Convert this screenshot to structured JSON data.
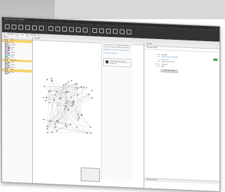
{
  "window": {
    "title": "Oxygen Forensic Detective",
    "controls": [
      "–",
      "□",
      "×"
    ]
  },
  "ribbon": {
    "buttons": [
      "",
      "",
      "",
      "",
      "",
      "",
      "",
      "",
      "",
      "",
      "",
      "",
      "",
      "",
      "",
      "",
      "",
      ""
    ]
  },
  "tabs": [
    "Start page",
    "Data",
    "Contacts"
  ],
  "left_panel": {
    "header": "Filters",
    "rows": [
      {
        "label": "Calls",
        "color": "#f6d46b",
        "hl": true
      },
      {
        "label": "Chats",
        "color": "#ff9800",
        "hl": false
      },
      {
        "label": "Contacts",
        "color": "#4caf50",
        "hl": false
      },
      {
        "label": "Events",
        "color": "#9c27b0",
        "hl": false
      },
      {
        "label": "Files",
        "color": "#3f51b5",
        "hl": false
      },
      {
        "label": "Groups",
        "color": "#e91e63",
        "hl": false
      },
      {
        "label": "Images",
        "color": "#00bcd4",
        "hl": false
      },
      {
        "label": "Links",
        "color": "#8bc34a",
        "hl": false
      },
      {
        "label": "Messages",
        "color": "#f6d46b",
        "hl": true
      },
      {
        "label": "Notes",
        "color": "#795548",
        "hl": false
      },
      {
        "label": "People",
        "color": "#607d8b",
        "hl": false
      },
      {
        "label": "Places",
        "color": "#ff5722",
        "hl": false
      },
      {
        "label": "Tags",
        "color": "#f6d46b",
        "hl": true
      },
      {
        "label": "Videos",
        "color": "#9e9e9e",
        "hl": false
      }
    ]
  },
  "center": {
    "header": "Contacts",
    "popup": {
      "p1": "Social Group ID 2173769888 1168490984 is a member of a group that might be important.",
      "p2": "Messages can be found in several devices.",
      "p3": "Go to the list of people.",
      "note": "Select the items to see the details of the relationship in the graph view."
    }
  },
  "right": {
    "header": "Details",
    "subheader": "Message Details",
    "rows": [
      {
        "k": "Type",
        "v": "Message",
        "lnk": false
      },
      {
        "k": "From",
        "v": "Social Group 2173769888",
        "lnk": true
      },
      {
        "k": "To",
        "v": "Group Chat",
        "lnk": true
      },
      {
        "k": "Time",
        "v": "2018-01-18 15:04:12",
        "lnk": false
      },
      {
        "k": "Direction",
        "v": "Incoming",
        "lnk": false
      },
      {
        "k": "Status",
        "v": "Read",
        "lnk": false
      }
    ],
    "button": "Show full message",
    "footer": "Selection Notes"
  },
  "colors": {
    "accent": "#2a64b8",
    "highlight": "#f6d46b",
    "status": "#2e9a3e"
  }
}
